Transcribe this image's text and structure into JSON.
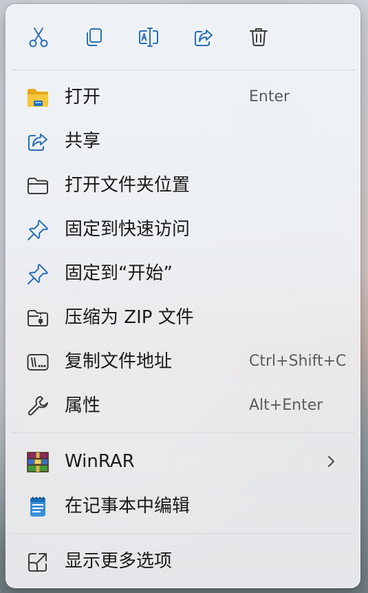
{
  "toolbar": {
    "cut": "剪切",
    "copy": "复制",
    "rename": "重命名",
    "share": "共享",
    "delete": "删除"
  },
  "items": [
    {
      "label": "打开",
      "shortcut": "Enter",
      "icon": "folder-open-icon"
    },
    {
      "label": "共享",
      "shortcut": "",
      "icon": "share-icon"
    },
    {
      "label": "打开文件夹位置",
      "shortcut": "",
      "icon": "folder-outline-icon"
    },
    {
      "label": "固定到快速访问",
      "shortcut": "",
      "icon": "pin-icon"
    },
    {
      "label": "固定到“开始”",
      "shortcut": "",
      "icon": "pin-icon"
    },
    {
      "label": "压缩为 ZIP 文件",
      "shortcut": "",
      "icon": "zip-folder-icon"
    },
    {
      "label": "复制文件地址",
      "shortcut": "Ctrl+Shift+C",
      "icon": "copy-path-icon"
    },
    {
      "label": "属性",
      "shortcut": "Alt+Enter",
      "icon": "wrench-icon"
    },
    {
      "label": "WinRAR",
      "shortcut": "",
      "icon": "winrar-icon"
    },
    {
      "label": "在记事本中编辑",
      "shortcut": "",
      "icon": "notepad-icon"
    },
    {
      "label": "显示更多选项",
      "shortcut": "",
      "icon": "more-options-icon"
    }
  ],
  "colors": {
    "accent": "#1a73c8",
    "folder_yellow": "#f5c02a",
    "text": "#1a1a1a",
    "shortcut_text": "#5c5c5c"
  }
}
